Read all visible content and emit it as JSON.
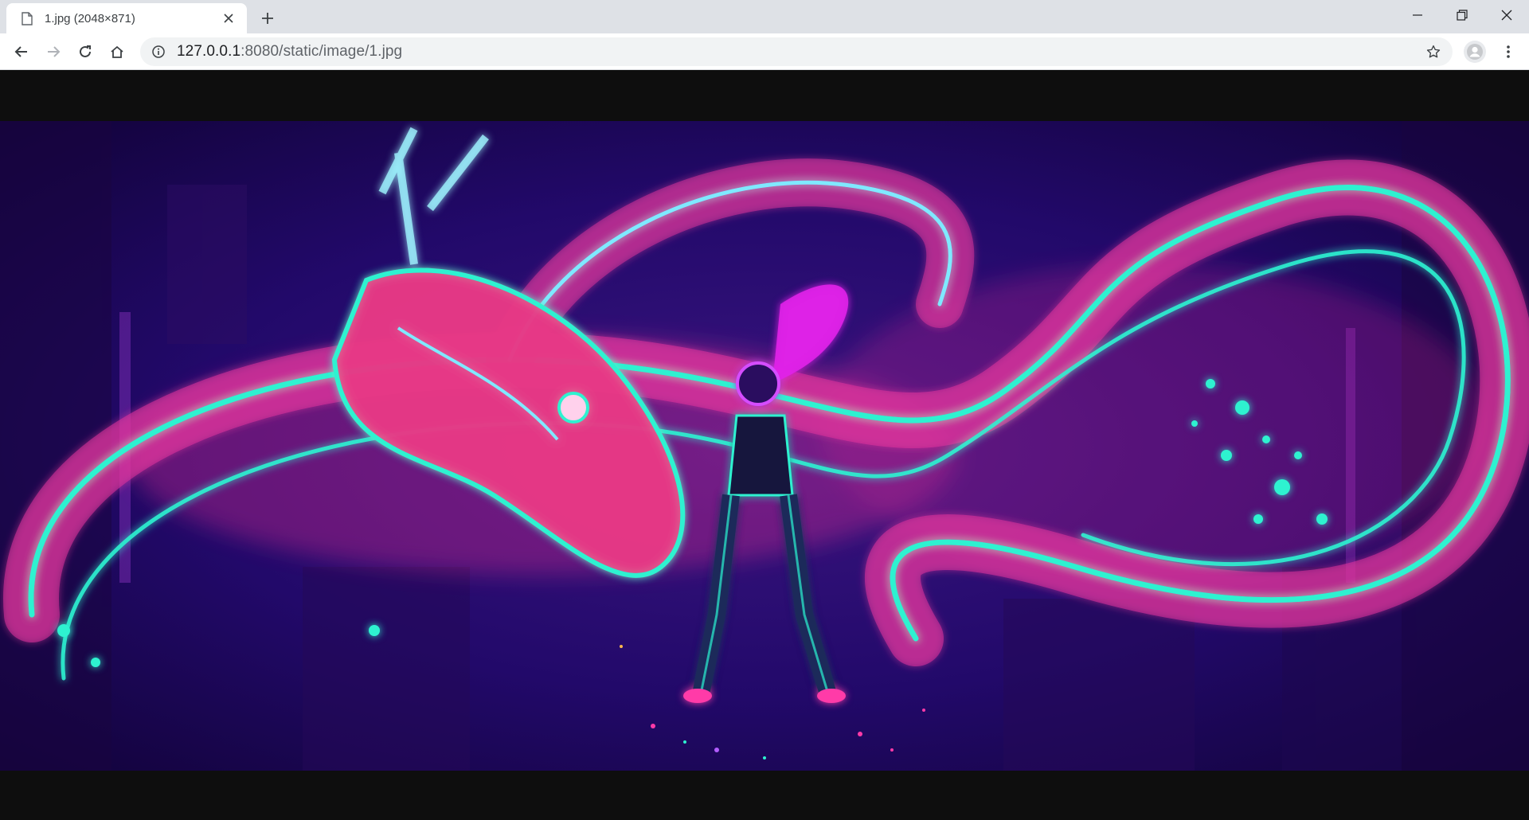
{
  "tab": {
    "title": "1.jpg (2048×871)",
    "file_icon": "file-icon",
    "close_icon": "close-icon"
  },
  "new_tab_icon": "plus-icon",
  "window_controls": [
    "minimize-icon",
    "restore-icon",
    "close-icon"
  ],
  "toolbar": {
    "back_icon": "arrow-left-icon",
    "forward_icon": "arrow-right-icon",
    "reload_icon": "reload-icon",
    "home_icon": "home-icon",
    "site_info_icon": "info-icon",
    "url_host": "127.0.0.1",
    "url_rest": ":8080/static/image/1.jpg",
    "bookmark_icon": "star-icon",
    "profile_icon": "avatar-icon",
    "menu_icon": "kebab-menu-icon"
  },
  "viewer": {
    "image_subject": "neon dragon artwork with figure",
    "colors": {
      "background": "#0e0e0e",
      "neon_cyan": "#2ef2d0",
      "neon_pink": "#ff3aa8",
      "deep_purple": "#2a0a5e"
    }
  }
}
